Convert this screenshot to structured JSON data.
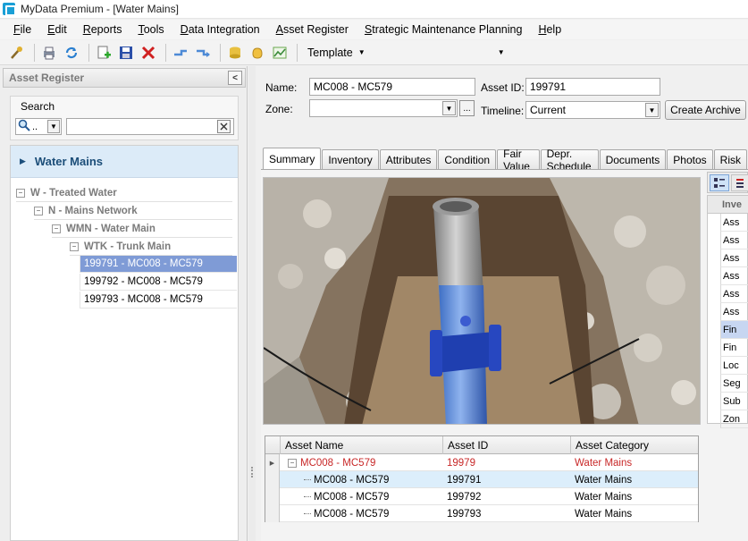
{
  "window": {
    "title": "MyData Premium - [Water Mains]"
  },
  "menu": [
    {
      "pre": "",
      "ul": "F",
      "post": "ile"
    },
    {
      "pre": "",
      "ul": "E",
      "post": "dit"
    },
    {
      "pre": "",
      "ul": "R",
      "post": "eports"
    },
    {
      "pre": "",
      "ul": "T",
      "post": "ools"
    },
    {
      "pre": "",
      "ul": "D",
      "post": "ata Integration"
    },
    {
      "pre": "",
      "ul": "A",
      "post": "sset Register"
    },
    {
      "pre": "",
      "ul": "S",
      "post": "trategic Maintenance Planning"
    },
    {
      "pre": "",
      "ul": "H",
      "post": "elp"
    }
  ],
  "toolbar": {
    "template_label": "Template",
    "template_combo_value": ""
  },
  "left_panel": {
    "header": "Asset Register",
    "collapse_glyph": "<",
    "search_label": "Search",
    "search_type_value": "..",
    "search_value": "",
    "root_label": "Water Mains",
    "nodes": [
      {
        "label": "W - Treated Water",
        "glyph": "−"
      },
      {
        "label": "N - Mains Network",
        "glyph": "−"
      },
      {
        "label": "WMN - Water Main",
        "glyph": "−"
      },
      {
        "label": "WTK - Trunk Main",
        "glyph": "−"
      }
    ],
    "leaves": [
      {
        "label": "199791 - MC008 - MC579",
        "selected": true
      },
      {
        "label": "199792 - MC008 - MC579",
        "selected": false
      },
      {
        "label": "199793 - MC008 - MC579",
        "selected": false
      }
    ]
  },
  "form": {
    "name_label": "Name:",
    "name_value": "MC008 - MC579",
    "asset_id_label": "Asset ID:",
    "asset_id_value": "199791",
    "zone_label": "Zone:",
    "zone_value": "",
    "zone_browse": "...",
    "timeline_label": "Timeline:",
    "timeline_value": "Current",
    "archive_button": "Create Archive"
  },
  "tabs": [
    "Summary",
    "Inventory",
    "Attributes",
    "Condition",
    "Fair Value",
    "Depr. Schedule",
    "Documents",
    "Photos",
    "Risk"
  ],
  "active_tab": "Summary",
  "grid": {
    "columns": [
      "Asset Name",
      "Asset ID",
      "Asset Category"
    ],
    "rows": [
      {
        "name": "MC008 - MC579",
        "id": "19979",
        "category": "Water Mains",
        "parent": true
      },
      {
        "name": "MC008 - MC579",
        "id": "199791",
        "category": "Water Mains",
        "parent": false,
        "selected": true
      },
      {
        "name": "MC008 - MC579",
        "id": "199792",
        "category": "Water Mains",
        "parent": false
      },
      {
        "name": "MC008 - MC579",
        "id": "199793",
        "category": "Water Mains",
        "parent": false
      }
    ]
  },
  "side_panel": {
    "header": "Inve",
    "items": [
      "Ass",
      "Ass",
      "Ass",
      "Ass",
      "Ass",
      "Ass",
      "Fin",
      "Fin",
      "Loc",
      "Seg",
      "Sub",
      "Zon"
    ],
    "selected_index": 6
  },
  "colors": {
    "accent": "#1b4d78",
    "selection": "#7f9bd6",
    "parent_row": "#c82828"
  }
}
